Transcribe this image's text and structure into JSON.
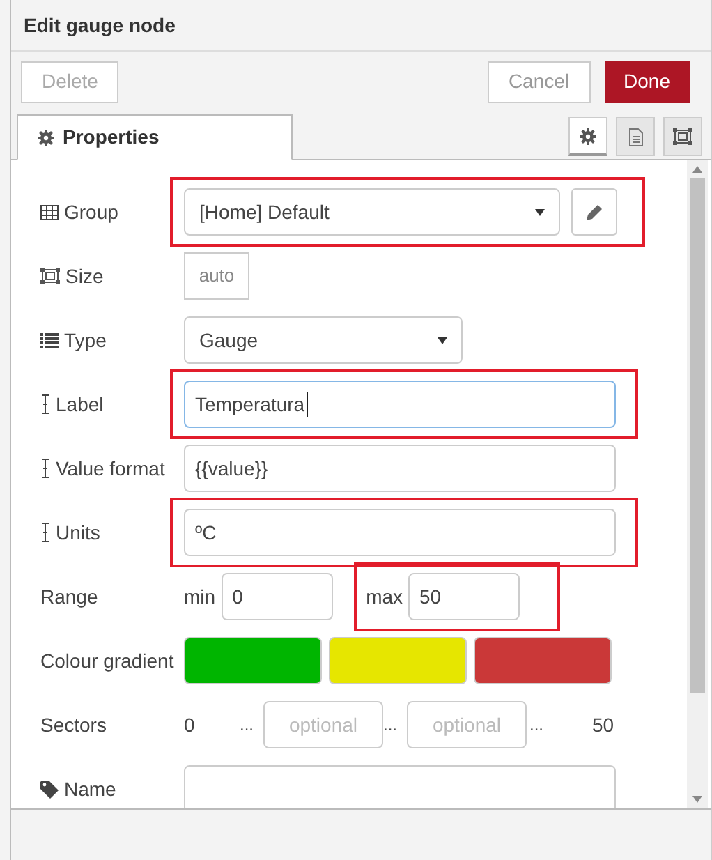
{
  "title": "Edit gauge node",
  "toolbar": {
    "delete": "Delete",
    "cancel": "Cancel",
    "done": "Done"
  },
  "tabs": [
    {
      "label": "Properties",
      "selected": true
    }
  ],
  "tab_buttons": [
    {
      "kind": "gear",
      "selected": true
    },
    {
      "kind": "doc",
      "selected": false
    },
    {
      "kind": "frame",
      "selected": false
    }
  ],
  "rows": [
    {
      "kind": "select",
      "label": "Group",
      "value": "[Home] Default",
      "edit_button": true,
      "highlighted": true
    },
    {
      "kind": "size",
      "label": "Size",
      "value": "auto"
    },
    {
      "kind": "select",
      "label": "Type",
      "value": "Gauge",
      "edit_button": false
    },
    {
      "kind": "text",
      "label": "Label",
      "value": "Temperatura",
      "focused": true,
      "highlighted": true
    },
    {
      "kind": "text",
      "label": "Value format",
      "value": "{{value}}"
    },
    {
      "kind": "text",
      "label": "Units",
      "value": "ºC",
      "highlighted": true
    },
    {
      "kind": "range",
      "label": "Range",
      "min_label": "min",
      "min": "0",
      "max_label": "max",
      "max": "50",
      "max_highlighted": true
    },
    {
      "kind": "colours",
      "label": "Colour gradient",
      "swatches": [
        {
          "color": "#00b500"
        },
        {
          "color": "#e6e600"
        },
        {
          "color": "#ca3838"
        }
      ]
    },
    {
      "kind": "sectors",
      "label": "Sectors",
      "start": "0",
      "sep": "...",
      "placeholders": [
        "optional",
        "optional"
      ],
      "end": "50"
    },
    {
      "kind": "text",
      "label": "Name"
    }
  ]
}
